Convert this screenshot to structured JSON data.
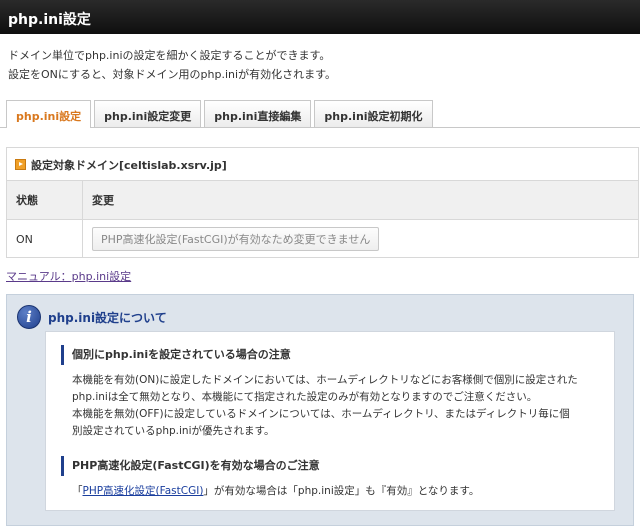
{
  "header": {
    "title": "php.ini設定"
  },
  "intro": {
    "line1": "ドメイン単位でphp.iniの設定を細かく設定することができます。",
    "line2": "設定をONにすると、対象ドメイン用のphp.iniが有効化されます。"
  },
  "tabs": [
    {
      "label": "php.ini設定",
      "active": true
    },
    {
      "label": "php.ini設定変更",
      "active": false
    },
    {
      "label": "php.ini直接編集",
      "active": false
    },
    {
      "label": "php.ini設定初期化",
      "active": false
    }
  ],
  "settings": {
    "heading": "設定対象ドメイン[celtislab.xsrv.jp]",
    "columns": [
      "状態",
      "変更"
    ],
    "row": {
      "status": "ON",
      "change_button": "PHP高速化設定(FastCGI)が有効なため変更できません"
    }
  },
  "manual_link": "マニュアル：php.ini設定",
  "info": {
    "title": "php.ini設定について",
    "sections": [
      {
        "title": "個別にphp.iniを設定されている場合の注意",
        "lines": [
          "本機能を有効(ON)に設定したドメインにおいては、ホームディレクトリなどにお客様側で個別に設定された",
          "php.iniは全て無効となり、本機能にて指定された設定のみが有効となりますのでご注意ください。",
          "本機能を無効(OFF)に設定しているドメインについては、ホームディレクトリ、またはディレクトリ毎に個",
          "別設定されているphp.iniが優先されます。"
        ]
      },
      {
        "title": "PHP高速化設定(FastCGI)を有効な場合のご注意",
        "text_before": "「",
        "link": "PHP高速化設定(FastCGI)",
        "text_after": "」が有効な場合は「php.ini設定」も『有効』となります。"
      }
    ]
  },
  "colors": {
    "title_bar": "#1a1a1a",
    "active_tab_text": "#d9781e",
    "info_panel_bg": "#dde4ec",
    "accent_blue": "#1f3f8c",
    "heading_marker": "#f0a028"
  },
  "icons": {
    "heading_marker": "orange-square-arrow-icon",
    "info": "info-icon"
  }
}
